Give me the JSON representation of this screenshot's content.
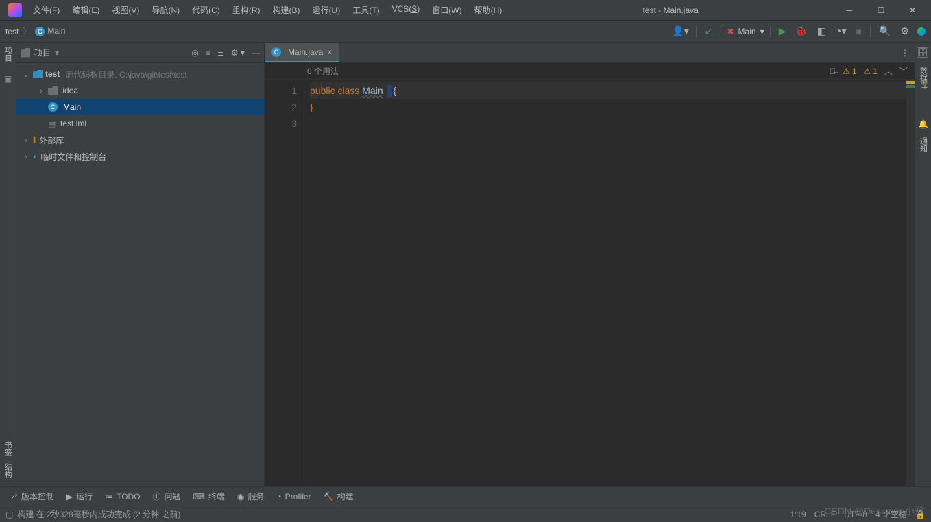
{
  "title_bar": {
    "title": "test - Main.java"
  },
  "menu": [
    {
      "l": "文件",
      "k": "F"
    },
    {
      "l": "编辑",
      "k": "E"
    },
    {
      "l": "视图",
      "k": "V"
    },
    {
      "l": "导航",
      "k": "N"
    },
    {
      "l": "代码",
      "k": "C"
    },
    {
      "l": "重构",
      "k": "R"
    },
    {
      "l": "构建",
      "k": "B"
    },
    {
      "l": "运行",
      "k": "U"
    },
    {
      "l": "工具",
      "k": "T"
    },
    {
      "l": "VCS",
      "k": "S"
    },
    {
      "l": "窗口",
      "k": "W"
    },
    {
      "l": "帮助",
      "k": "H"
    }
  ],
  "breadcrumb": {
    "project": "test",
    "file": "Main"
  },
  "run_config": {
    "name": "Main"
  },
  "project_panel": {
    "title": "项目",
    "root": {
      "name": "test",
      "hint": "源代码根目录",
      "path": "C:\\java\\git\\test\\test"
    },
    "idea": ".idea",
    "main": "Main",
    "iml": "test.iml",
    "ext_libs": "外部库",
    "scratches": "临时文件和控制台"
  },
  "tabs": [
    {
      "label": "Main.java"
    }
  ],
  "info_bar": {
    "usages": "0 个用法",
    "warn1": "1",
    "warn2": "1"
  },
  "code": {
    "line1_kw1": "public",
    "line1_kw2": "class",
    "line1_cls": "Main",
    "line1_open": "{",
    "line2": "}",
    "nums": [
      "1",
      "2",
      "3"
    ]
  },
  "side_labels": {
    "project": "项目",
    "bookmarks": "书签",
    "structure": "结构",
    "database": "数据库",
    "notifications": "通知"
  },
  "bottom_tools": {
    "vcs": "版本控制",
    "run": "运行",
    "todo": "TODO",
    "problems": "问题",
    "terminal": "终端",
    "services": "服务",
    "profiler": "Profiler",
    "build": "构建"
  },
  "status": {
    "msg": "构建 在 2秒328毫秒内成功完成 (2 分钟 之前)",
    "pos": "1:19",
    "eol": "CRLF",
    "enc": "UTF-8",
    "indent": "4 个空格"
  },
  "watermark": "CSDN @Designer 小郑"
}
